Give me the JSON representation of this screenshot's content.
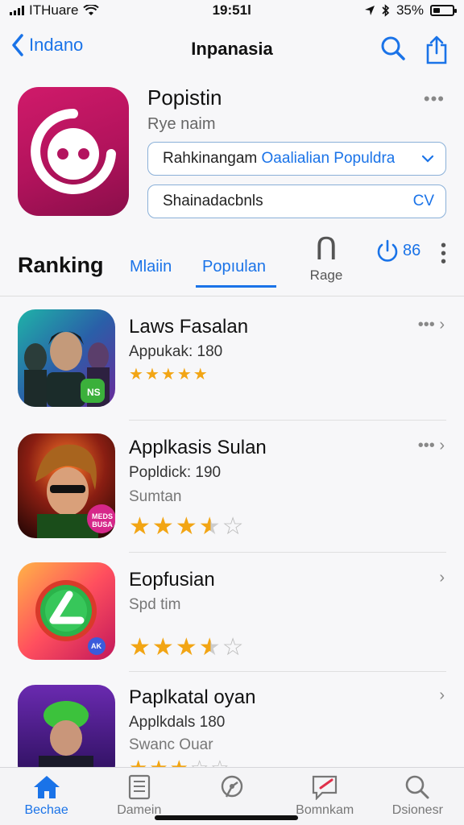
{
  "status_bar": {
    "carrier": "ITHuare",
    "time": "19:51l",
    "battery": "35%",
    "battery_level": 0.35
  },
  "nav": {
    "back_label": "Indano",
    "title": "Inpanasia"
  },
  "app": {
    "name": "Popistin",
    "subtitle": "Rye naim",
    "more": "•••",
    "pill1": {
      "prefix": "Rahkinangam",
      "highlight": "Oaalialian Populdra"
    },
    "pill2": {
      "label": "Shainadacbnls",
      "end": "CV"
    }
  },
  "segment": {
    "heading": "Ranking",
    "tabs": [
      "Mlaiin",
      "Popıulan"
    ],
    "range_glyph": "Ո",
    "range_label": "Rage",
    "share_count": "86"
  },
  "list": [
    {
      "title": "Laws Fasalan",
      "line2": "Appukak: 180",
      "line3": "",
      "rating": 5,
      "more": "•••"
    },
    {
      "title": "Applkasis Sulan",
      "line2": "Popldick: 190",
      "line3": "Sumtan",
      "rating": 3.5,
      "more": "•••"
    },
    {
      "title": "Eopfusian",
      "line2": "Spd tim",
      "line3": "",
      "rating": 3.5,
      "more": ""
    },
    {
      "title": "Paplkatal oyan",
      "line2": "Applkdals 180",
      "line3": "Swanc Ouar",
      "rating": 3,
      "more": ""
    }
  ],
  "thumb_badges": [
    "NS",
    "MEDS BUSA",
    "AK"
  ],
  "tabbar": [
    {
      "label": "Bechae",
      "icon": "home-icon",
      "active": true
    },
    {
      "label": "Damein",
      "icon": "document-icon",
      "active": false
    },
    {
      "label": "",
      "icon": "location-icon",
      "active": false
    },
    {
      "label": "Bomnkam",
      "icon": "message-icon",
      "active": false
    },
    {
      "label": "Dsionesr",
      "icon": "search-icon",
      "active": false
    }
  ],
  "colors": {
    "accent": "#1a73e8",
    "app_icon": "#c2185b",
    "star": "#f2a514"
  }
}
